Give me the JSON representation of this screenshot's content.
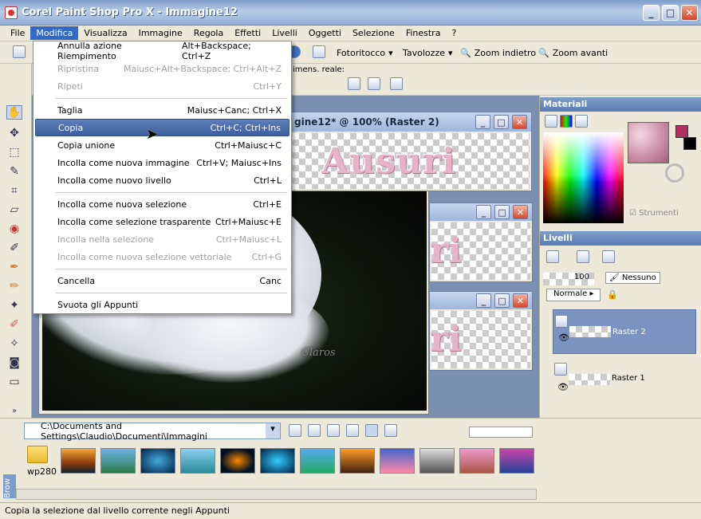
{
  "window": {
    "title": "Corel Paint Shop Pro X - Immagine12"
  },
  "menubar": [
    "File",
    "Modifica",
    "Visualizza",
    "Immagine",
    "Regola",
    "Effetti",
    "Livelli",
    "Oggetti",
    "Selezione",
    "Finestra",
    "?"
  ],
  "toolbar": {
    "fotoritocco": "Fotoritocco",
    "tavolozze": "Tavolozze",
    "zoom_out": "Zoom indietro",
    "zoom_in": "Zoom avanti",
    "dimens": "imens. reale:"
  },
  "dropdown": [
    {
      "label": "Annulla azione Riempimento",
      "shortcut": "Alt+Backspace; Ctrl+Z",
      "enabled": true
    },
    {
      "label": "Ripristina",
      "shortcut": "Maiusc+Alt+Backspace; Ctrl+Alt+Z",
      "enabled": false
    },
    {
      "label": "Ripeti",
      "shortcut": "Ctrl+Y",
      "enabled": false
    },
    {
      "label": "Taglia",
      "shortcut": "Maiusc+Canc; Ctrl+X",
      "enabled": true
    },
    {
      "label": "Copia",
      "shortcut": "Ctrl+C; Ctrl+Ins",
      "enabled": true,
      "highlighted": true
    },
    {
      "label": "Copia unione",
      "shortcut": "Ctrl+Maiusc+C",
      "enabled": true
    },
    {
      "label": "Incolla come nuova immagine",
      "shortcut": "Ctrl+V; Maiusc+Ins",
      "enabled": true
    },
    {
      "label": "Incolla come nuovo livello",
      "shortcut": "Ctrl+L",
      "enabled": true
    },
    {
      "label": "Incolla come nuova selezione",
      "shortcut": "Ctrl+E",
      "enabled": true
    },
    {
      "label": "Incolla come selezione trasparente",
      "shortcut": "Ctrl+Maiusc+E",
      "enabled": true
    },
    {
      "label": "Incolla nella selezione",
      "shortcut": "Ctrl+Maiusc+L",
      "enabled": false
    },
    {
      "label": "Incolla come nuova selezione vettoriale",
      "shortcut": "Ctrl+G",
      "enabled": false
    },
    {
      "label": "Cancella",
      "shortcut": "Canc",
      "enabled": true
    },
    {
      "label": "Svuota gli Appunti",
      "shortcut": "",
      "enabled": true
    }
  ],
  "image_window": {
    "title": "gine12* @ 100% (Raster 2)",
    "text": "Ausuri",
    "partial_text": "ri",
    "watermark": "Claros"
  },
  "materiali": {
    "title": "Materiali",
    "strumenti": "Strumenti"
  },
  "livelli": {
    "title": "Livelli",
    "opacity": "100",
    "blend_mode": "Normale",
    "mask": "Nessuno",
    "layers": [
      {
        "name": "Raster 2",
        "selected": true
      },
      {
        "name": "Raster 1",
        "selected": false
      }
    ]
  },
  "browser": {
    "path": "C:\\Documents and Settings\\Claudio\\Documenti\\Immagini",
    "folder": "wp280",
    "side_label": "Brow"
  },
  "status": "Copia la selezione dal livello corrente negli Appunti"
}
